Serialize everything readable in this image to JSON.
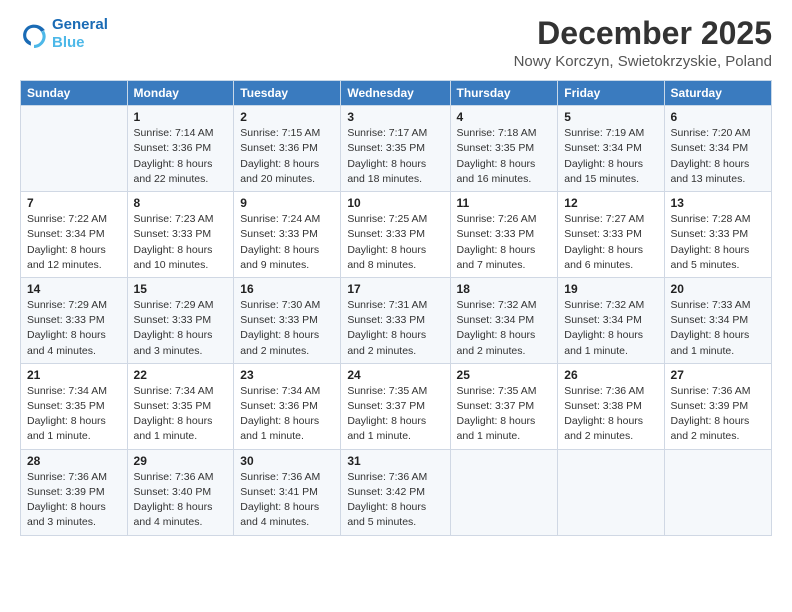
{
  "header": {
    "logo_line1": "General",
    "logo_line2": "Blue",
    "title": "December 2025",
    "subtitle": "Nowy Korczyn, Swietokrzyskie, Poland"
  },
  "days_of_week": [
    "Sunday",
    "Monday",
    "Tuesday",
    "Wednesday",
    "Thursday",
    "Friday",
    "Saturday"
  ],
  "weeks": [
    [
      {
        "day": "",
        "info": ""
      },
      {
        "day": "1",
        "info": "Sunrise: 7:14 AM\nSunset: 3:36 PM\nDaylight: 8 hours\nand 22 minutes."
      },
      {
        "day": "2",
        "info": "Sunrise: 7:15 AM\nSunset: 3:36 PM\nDaylight: 8 hours\nand 20 minutes."
      },
      {
        "day": "3",
        "info": "Sunrise: 7:17 AM\nSunset: 3:35 PM\nDaylight: 8 hours\nand 18 minutes."
      },
      {
        "day": "4",
        "info": "Sunrise: 7:18 AM\nSunset: 3:35 PM\nDaylight: 8 hours\nand 16 minutes."
      },
      {
        "day": "5",
        "info": "Sunrise: 7:19 AM\nSunset: 3:34 PM\nDaylight: 8 hours\nand 15 minutes."
      },
      {
        "day": "6",
        "info": "Sunrise: 7:20 AM\nSunset: 3:34 PM\nDaylight: 8 hours\nand 13 minutes."
      }
    ],
    [
      {
        "day": "7",
        "info": "Sunrise: 7:22 AM\nSunset: 3:34 PM\nDaylight: 8 hours\nand 12 minutes."
      },
      {
        "day": "8",
        "info": "Sunrise: 7:23 AM\nSunset: 3:33 PM\nDaylight: 8 hours\nand 10 minutes."
      },
      {
        "day": "9",
        "info": "Sunrise: 7:24 AM\nSunset: 3:33 PM\nDaylight: 8 hours\nand 9 minutes."
      },
      {
        "day": "10",
        "info": "Sunrise: 7:25 AM\nSunset: 3:33 PM\nDaylight: 8 hours\nand 8 minutes."
      },
      {
        "day": "11",
        "info": "Sunrise: 7:26 AM\nSunset: 3:33 PM\nDaylight: 8 hours\nand 7 minutes."
      },
      {
        "day": "12",
        "info": "Sunrise: 7:27 AM\nSunset: 3:33 PM\nDaylight: 8 hours\nand 6 minutes."
      },
      {
        "day": "13",
        "info": "Sunrise: 7:28 AM\nSunset: 3:33 PM\nDaylight: 8 hours\nand 5 minutes."
      }
    ],
    [
      {
        "day": "14",
        "info": "Sunrise: 7:29 AM\nSunset: 3:33 PM\nDaylight: 8 hours\nand 4 minutes."
      },
      {
        "day": "15",
        "info": "Sunrise: 7:29 AM\nSunset: 3:33 PM\nDaylight: 8 hours\nand 3 minutes."
      },
      {
        "day": "16",
        "info": "Sunrise: 7:30 AM\nSunset: 3:33 PM\nDaylight: 8 hours\nand 2 minutes."
      },
      {
        "day": "17",
        "info": "Sunrise: 7:31 AM\nSunset: 3:33 PM\nDaylight: 8 hours\nand 2 minutes."
      },
      {
        "day": "18",
        "info": "Sunrise: 7:32 AM\nSunset: 3:34 PM\nDaylight: 8 hours\nand 2 minutes."
      },
      {
        "day": "19",
        "info": "Sunrise: 7:32 AM\nSunset: 3:34 PM\nDaylight: 8 hours\nand 1 minute."
      },
      {
        "day": "20",
        "info": "Sunrise: 7:33 AM\nSunset: 3:34 PM\nDaylight: 8 hours\nand 1 minute."
      }
    ],
    [
      {
        "day": "21",
        "info": "Sunrise: 7:34 AM\nSunset: 3:35 PM\nDaylight: 8 hours\nand 1 minute."
      },
      {
        "day": "22",
        "info": "Sunrise: 7:34 AM\nSunset: 3:35 PM\nDaylight: 8 hours\nand 1 minute."
      },
      {
        "day": "23",
        "info": "Sunrise: 7:34 AM\nSunset: 3:36 PM\nDaylight: 8 hours\nand 1 minute."
      },
      {
        "day": "24",
        "info": "Sunrise: 7:35 AM\nSunset: 3:37 PM\nDaylight: 8 hours\nand 1 minute."
      },
      {
        "day": "25",
        "info": "Sunrise: 7:35 AM\nSunset: 3:37 PM\nDaylight: 8 hours\nand 1 minute."
      },
      {
        "day": "26",
        "info": "Sunrise: 7:36 AM\nSunset: 3:38 PM\nDaylight: 8 hours\nand 2 minutes."
      },
      {
        "day": "27",
        "info": "Sunrise: 7:36 AM\nSunset: 3:39 PM\nDaylight: 8 hours\nand 2 minutes."
      }
    ],
    [
      {
        "day": "28",
        "info": "Sunrise: 7:36 AM\nSunset: 3:39 PM\nDaylight: 8 hours\nand 3 minutes."
      },
      {
        "day": "29",
        "info": "Sunrise: 7:36 AM\nSunset: 3:40 PM\nDaylight: 8 hours\nand 4 minutes."
      },
      {
        "day": "30",
        "info": "Sunrise: 7:36 AM\nSunset: 3:41 PM\nDaylight: 8 hours\nand 4 minutes."
      },
      {
        "day": "31",
        "info": "Sunrise: 7:36 AM\nSunset: 3:42 PM\nDaylight: 8 hours\nand 5 minutes."
      },
      {
        "day": "",
        "info": ""
      },
      {
        "day": "",
        "info": ""
      },
      {
        "day": "",
        "info": ""
      }
    ]
  ]
}
